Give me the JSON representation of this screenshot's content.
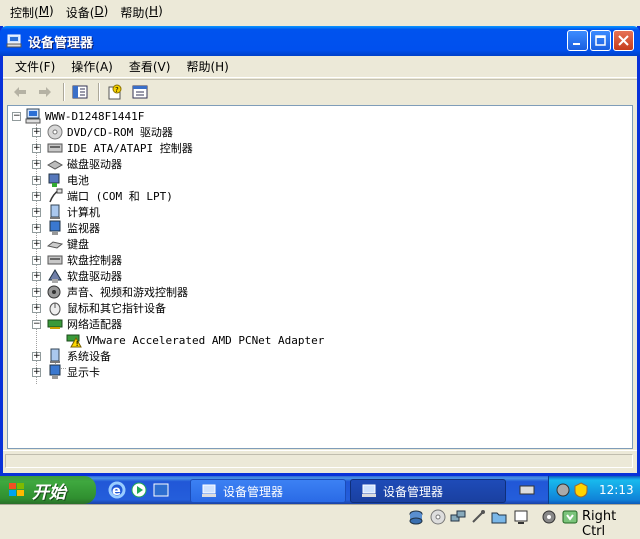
{
  "host_menu": [
    {
      "label": "控制(",
      "key": "M",
      "close": ")"
    },
    {
      "label": "设备(",
      "key": "D",
      "close": ")"
    },
    {
      "label": "帮助(",
      "key": "H",
      "close": ")"
    }
  ],
  "window": {
    "title": "设备管理器"
  },
  "menu": [
    "文件(F)",
    "操作(A)",
    "查看(V)",
    "帮助(H)"
  ],
  "tree": {
    "root": "WWW-D1248F1441F",
    "items": [
      {
        "label": "DVD/CD-ROM 驱动器",
        "icon": "cdrom-icon",
        "expanded": false
      },
      {
        "label": "IDE ATA/ATAPI 控制器",
        "icon": "ide-controller-icon",
        "expanded": false
      },
      {
        "label": "磁盘驱动器",
        "icon": "disk-drive-icon",
        "expanded": false
      },
      {
        "label": "电池",
        "icon": "battery-icon",
        "expanded": false
      },
      {
        "label": "端口 (COM 和 LPT)",
        "icon": "port-icon",
        "expanded": false
      },
      {
        "label": "计算机",
        "icon": "computer-icon",
        "expanded": false
      },
      {
        "label": "监视器",
        "icon": "monitor-icon",
        "expanded": false
      },
      {
        "label": "键盘",
        "icon": "keyboard-icon",
        "expanded": false
      },
      {
        "label": "软盘控制器",
        "icon": "floppy-controller-icon",
        "expanded": false
      },
      {
        "label": "软盘驱动器",
        "icon": "floppy-drive-icon",
        "expanded": false
      },
      {
        "label": "声音、视频和游戏控制器",
        "icon": "sound-icon",
        "expanded": false
      },
      {
        "label": "鼠标和其它指针设备",
        "icon": "mouse-icon",
        "expanded": false
      },
      {
        "label": "网络适配器",
        "icon": "network-adapter-icon",
        "expanded": true,
        "children": [
          {
            "label": "VMware Accelerated AMD PCNet Adapter",
            "icon": "network-card-warning-icon"
          }
        ]
      },
      {
        "label": "系统设备",
        "icon": "system-devices-icon",
        "expanded": false
      },
      {
        "label": "显示卡",
        "icon": "display-adapter-icon",
        "expanded": false
      }
    ]
  },
  "taskbar": {
    "start": "开始",
    "tasks": [
      "设备管理器",
      "设备管理器"
    ],
    "clock": "12:13"
  },
  "host_status": {
    "hostkey": "Right Ctrl"
  }
}
